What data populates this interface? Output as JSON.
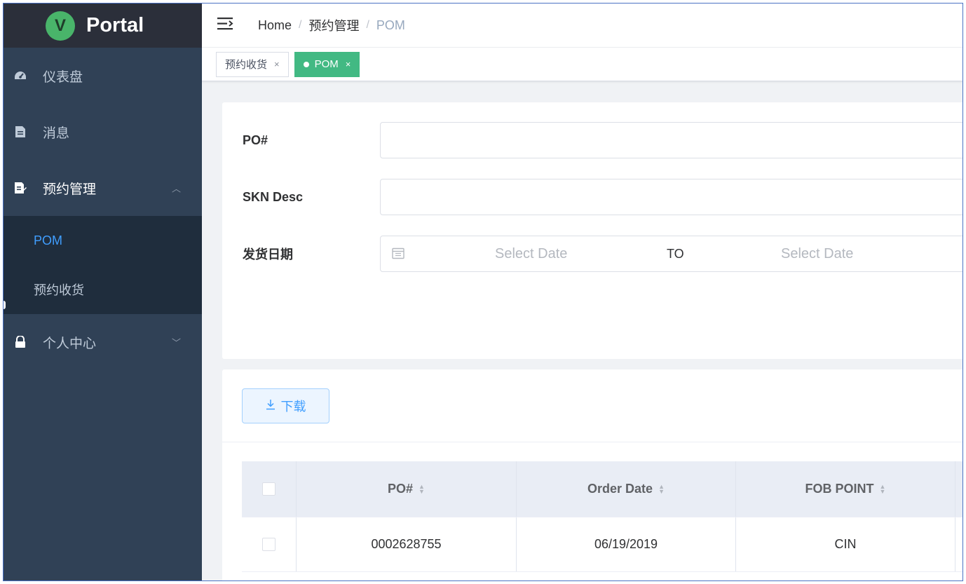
{
  "app": {
    "logo_letter": "V",
    "title": "Portal",
    "brand_color": "#42b983"
  },
  "sidebar": {
    "items": [
      {
        "label": "仪表盘",
        "icon": "dashboard-icon"
      },
      {
        "label": "消息",
        "icon": "document-icon"
      },
      {
        "label": "预约管理",
        "icon": "edit-doc-icon",
        "expanded": true,
        "children": [
          {
            "label": "POM",
            "active": true
          },
          {
            "label": "预约收货"
          }
        ]
      },
      {
        "label": "个人中心",
        "icon": "lock-icon",
        "expanded": false
      }
    ]
  },
  "breadcrumb": {
    "home": "Home",
    "section": "预约管理",
    "current": "POM"
  },
  "tags": [
    {
      "label": "预约收货",
      "active": false
    },
    {
      "label": "POM",
      "active": true
    }
  ],
  "filters": {
    "po_label": "PO#",
    "po_value": "",
    "skn_label": "SKN Desc",
    "skn_value": "",
    "ship_date_label": "发货日期",
    "date_start_placeholder": "Select Date",
    "date_to": "TO",
    "date_end_placeholder": "Select Date"
  },
  "toolbar": {
    "download_label": "下载"
  },
  "table": {
    "columns": [
      "PO#",
      "Order Date",
      "FOB POINT"
    ],
    "rows": [
      {
        "po": "0002628755",
        "order_date": "06/19/2019",
        "fob_point": "CIN"
      }
    ]
  }
}
